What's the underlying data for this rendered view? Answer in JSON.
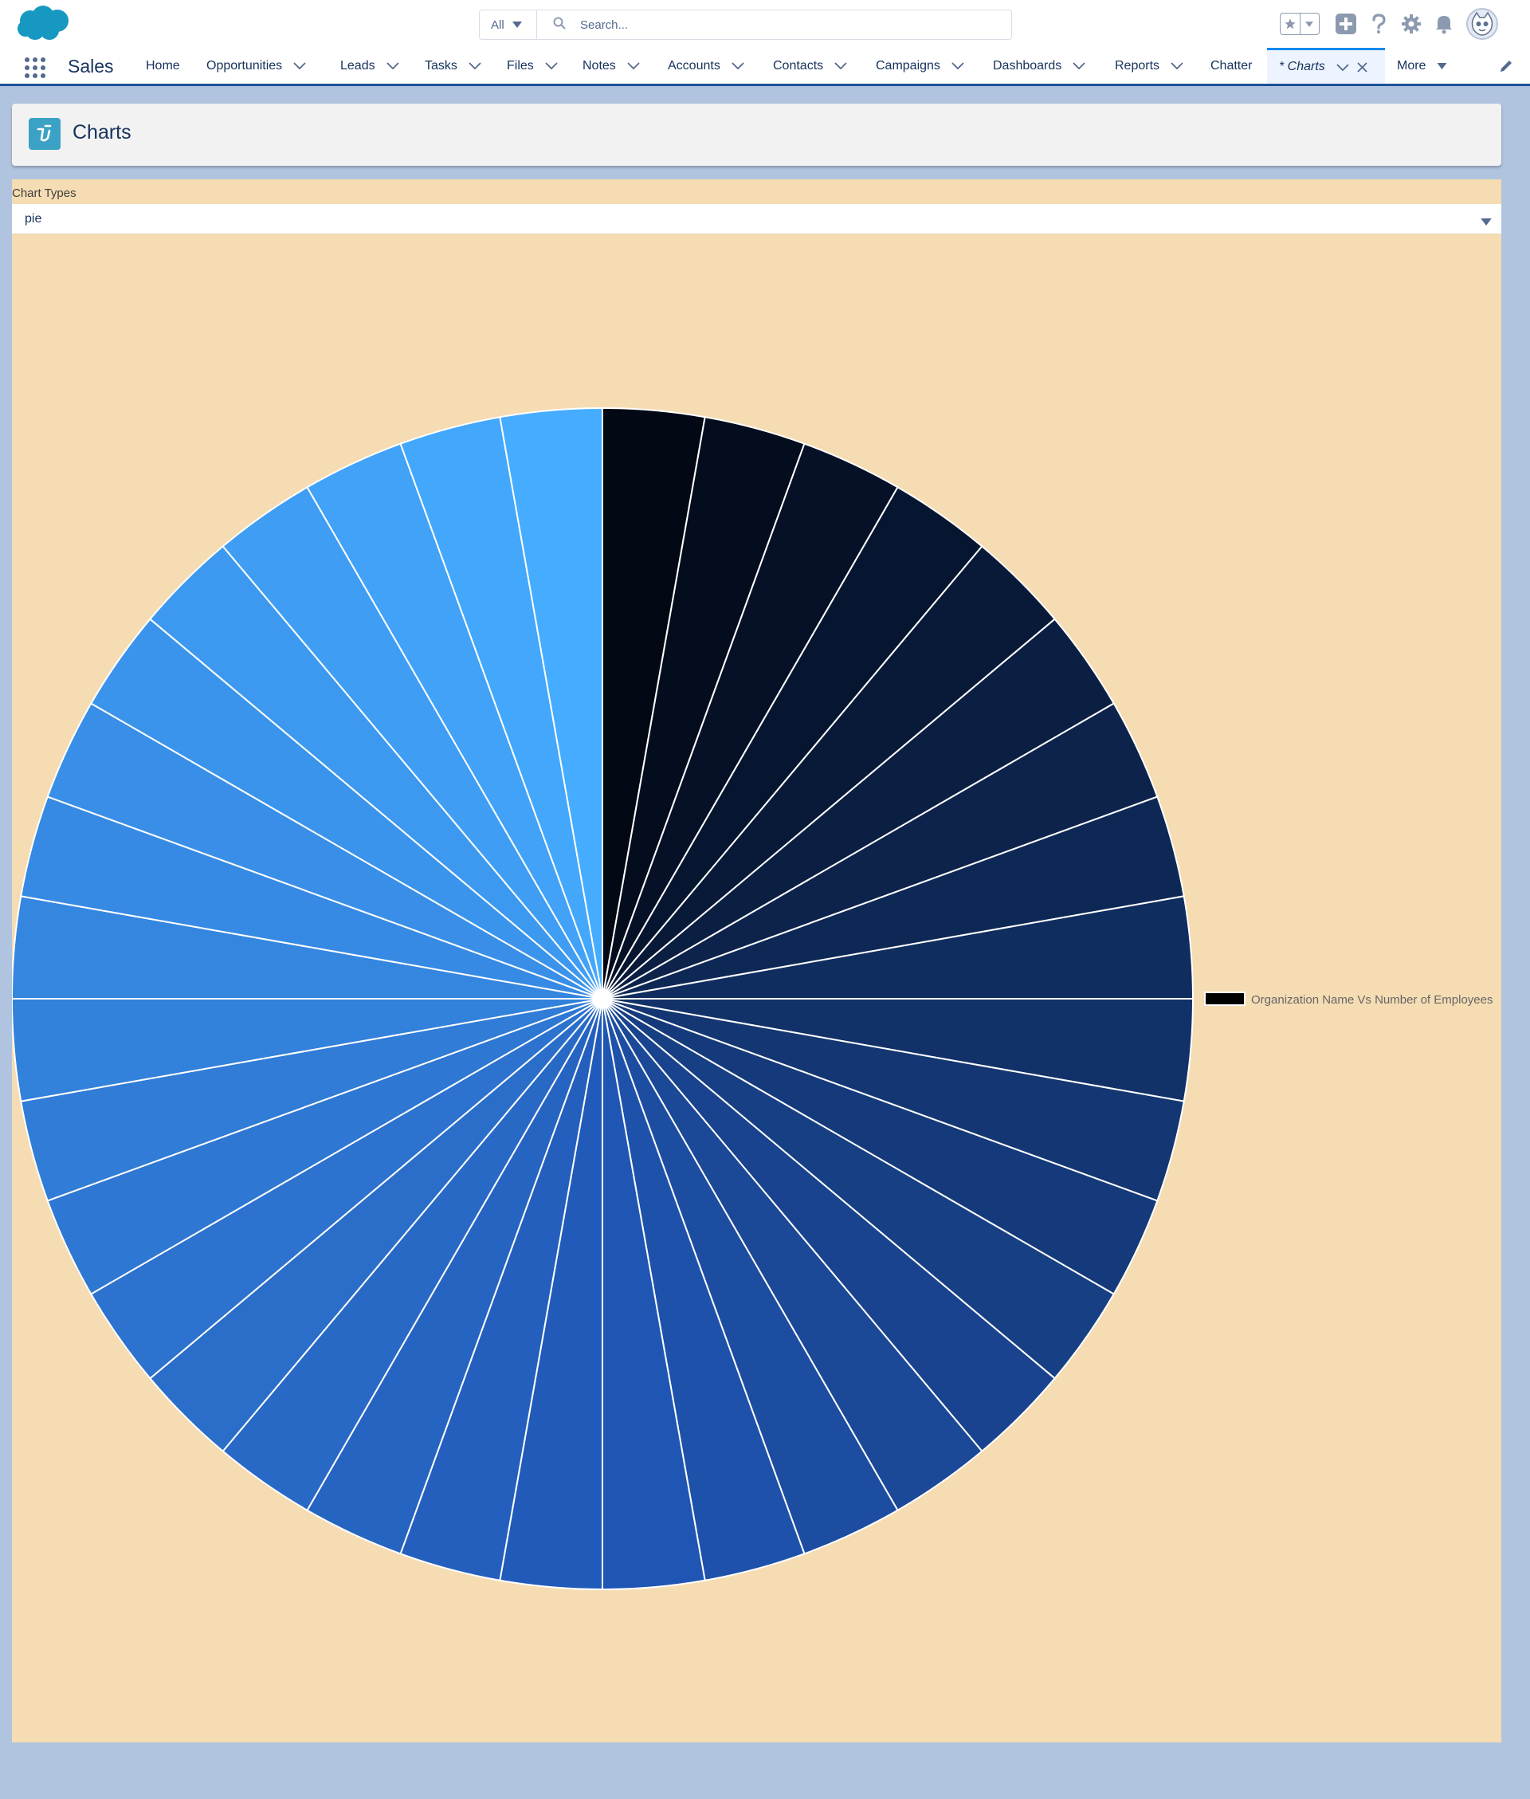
{
  "header": {
    "search_scope": "All",
    "search_placeholder": "Search..."
  },
  "nav": {
    "app_name": "Sales",
    "items": [
      {
        "label": "Home",
        "dropdown": false
      },
      {
        "label": "Opportunities",
        "dropdown": true
      },
      {
        "label": "Leads",
        "dropdown": true
      },
      {
        "label": "Tasks",
        "dropdown": true
      },
      {
        "label": "Files",
        "dropdown": true
      },
      {
        "label": "Notes",
        "dropdown": true
      },
      {
        "label": "Accounts",
        "dropdown": true
      },
      {
        "label": "Contacts",
        "dropdown": true
      },
      {
        "label": "Campaigns",
        "dropdown": true
      },
      {
        "label": "Dashboards",
        "dropdown": true
      },
      {
        "label": "Reports",
        "dropdown": true
      },
      {
        "label": "Chatter",
        "dropdown": false
      }
    ],
    "active_tab": "* Charts",
    "more_label": "More"
  },
  "page": {
    "title": "Charts",
    "field_label": "Chart Types",
    "selected_chart_type": "pie"
  },
  "chart_data": {
    "type": "pie",
    "title": "",
    "legend": {
      "label": "Organization Name Vs Number of Employees",
      "position": "right",
      "swatch_color": "#000000"
    },
    "slices": 36,
    "values": [
      1,
      1,
      1,
      1,
      1,
      1,
      1,
      1,
      1,
      1,
      1,
      1,
      1,
      1,
      1,
      1,
      1,
      1,
      1,
      1,
      1,
      1,
      1,
      1,
      1,
      1,
      1,
      1,
      1,
      1,
      1,
      1,
      1,
      1,
      1,
      1
    ],
    "start_color": "#020814",
    "mid_color": "#2158b8",
    "end_color": "#45acff",
    "slice_border_color": "#ffffff"
  }
}
